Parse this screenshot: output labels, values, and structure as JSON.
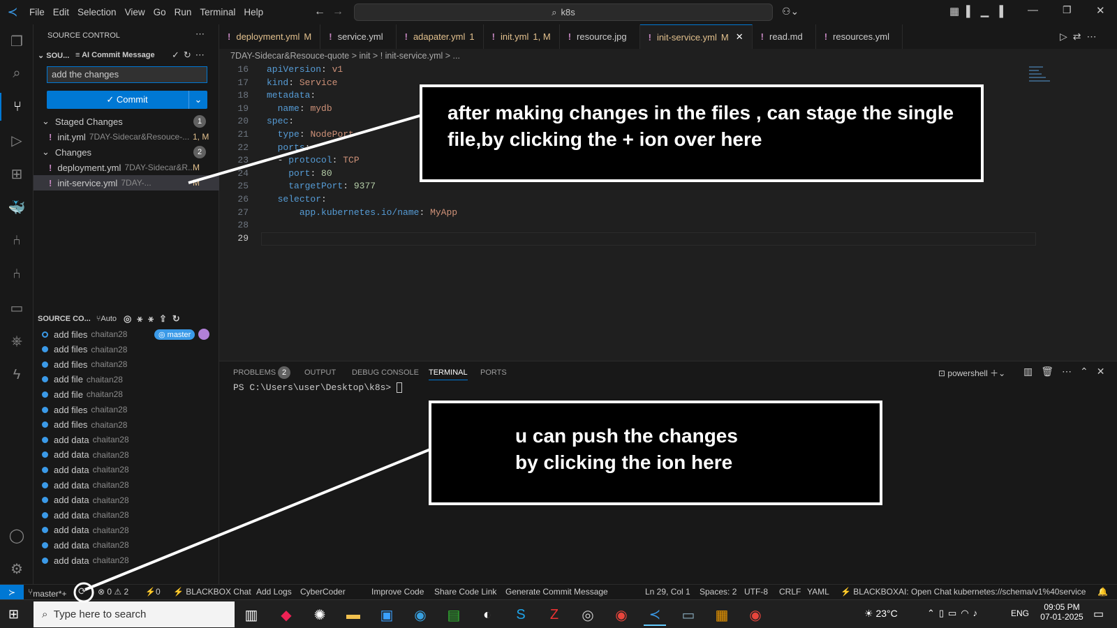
{
  "menu": [
    "File",
    "Edit",
    "Selection",
    "View",
    "Go",
    "Run",
    "Terminal",
    "Help"
  ],
  "search": "k8s",
  "sidebar": {
    "title": "SOURCE CONTROL",
    "repo_label": "SOU...",
    "ai_label": "AI Commit Message",
    "commit_input": "add the changes",
    "commit_button": "✓ Commit",
    "staged": {
      "label": "Staged Changes",
      "count": "1",
      "files": [
        {
          "name": "init.yml",
          "path": "7DAY-Sidecar&Resouce-...",
          "status": "1, M"
        }
      ]
    },
    "changes": {
      "label": "Changes",
      "count": "2",
      "files": [
        {
          "name": "deployment.yml",
          "path": "7DAY-Sidecar&R...",
          "status": "M"
        },
        {
          "name": "init-service.yml",
          "path": "7DAY-...",
          "status": "M"
        }
      ]
    },
    "graph": {
      "label": "SOURCE CO...",
      "auto": "Auto",
      "branch": "master",
      "commits": [
        {
          "msg": "add files",
          "author": "chaitan28"
        },
        {
          "msg": "add  files",
          "author": "chaitan28"
        },
        {
          "msg": "add files",
          "author": "chaitan28"
        },
        {
          "msg": "add file",
          "author": "chaitan28"
        },
        {
          "msg": "add file",
          "author": "chaitan28"
        },
        {
          "msg": "add files",
          "author": "chaitan28"
        },
        {
          "msg": "add files",
          "author": "chaitan28"
        },
        {
          "msg": "add data",
          "author": "chaitan28"
        },
        {
          "msg": "add data",
          "author": "chaitan28"
        },
        {
          "msg": "add data",
          "author": "chaitan28"
        },
        {
          "msg": "add data",
          "author": "chaitan28"
        },
        {
          "msg": "add data",
          "author": "chaitan28"
        },
        {
          "msg": "add data",
          "author": "chaitan28"
        },
        {
          "msg": "add data",
          "author": "chaitan28"
        },
        {
          "msg": "add data",
          "author": "chaitan28"
        },
        {
          "msg": "add data",
          "author": "chaitan28"
        }
      ]
    }
  },
  "tabs": [
    {
      "name": "deployment.yml",
      "status": "M",
      "color": "#e2c08d"
    },
    {
      "name": "service.yml",
      "status": "",
      "color": "#cccccc"
    },
    {
      "name": "adapater.yml",
      "status": "1",
      "color": "#e2c08d"
    },
    {
      "name": "init.yml",
      "status": "1, M",
      "color": "#e2c08d"
    },
    {
      "name": "resource.jpg",
      "status": "",
      "color": "#cccccc"
    },
    {
      "name": "init-service.yml",
      "status": "M",
      "color": "#e2c08d"
    },
    {
      "name": "read.md",
      "status": "",
      "color": "#cccccc"
    },
    {
      "name": "resources.yml",
      "status": "",
      "color": "#cccccc"
    }
  ],
  "breadcrumb": "7DAY-Sidecar&Resouce-quote > init > ! init-service.yml > ...",
  "code": [
    {
      "n": "16",
      "t": "apiVersion: v1"
    },
    {
      "n": "17",
      "t": "kind: Service"
    },
    {
      "n": "18",
      "t": "metadata:"
    },
    {
      "n": "19",
      "t": "  name: mydb"
    },
    {
      "n": "20",
      "t": "spec:"
    },
    {
      "n": "21",
      "t": "  type: NodePort"
    },
    {
      "n": "22",
      "t": "  ports:"
    },
    {
      "n": "23",
      "t": "  - protocol: TCP"
    },
    {
      "n": "24",
      "t": "    port: 80"
    },
    {
      "n": "25",
      "t": "    targetPort: 9377"
    },
    {
      "n": "26",
      "t": "  selector:"
    },
    {
      "n": "27",
      "t": "      app.kubernetes.io/name: MyApp"
    },
    {
      "n": "28",
      "t": ""
    },
    {
      "n": "29",
      "t": ""
    }
  ],
  "panel": {
    "tabs": [
      "PROBLEMS",
      "OUTPUT",
      "DEBUG CONSOLE",
      "TERMINAL",
      "PORTS"
    ],
    "problems_count": "2",
    "shell": "powershell",
    "prompt": "PS C:\\Users\\user\\Desktop\\k8s> "
  },
  "annotations": {
    "top": "after making changes in the files , can stage the single file,by clicking the + ion over here",
    "bottom1": "u can push the changes",
    "bottom2": "by clicking the ion here"
  },
  "status": {
    "branch": "master*+",
    "problems": "⊗ 0 ⚠ 2",
    "ports": "⚡0",
    "items": [
      "⚡ BLACKBOX Chat",
      "Add Logs",
      "CyberCoder",
      "Improve Code",
      "Share Code Link",
      "Generate Commit Message"
    ],
    "pos": "Ln 29, Col 1",
    "spaces": "Spaces: 2",
    "enc": "UTF-8",
    "eol": "CRLF",
    "lang": "YAML",
    "bb": "⚡ BLACKBOXAI: Open Chat",
    "schema": "kubernetes://schema/v1%40service"
  },
  "taskbar": {
    "search": "Type here to search",
    "temp": "23°C",
    "lang": "ENG",
    "time": "09:05 PM",
    "date": "07-01-2025"
  }
}
